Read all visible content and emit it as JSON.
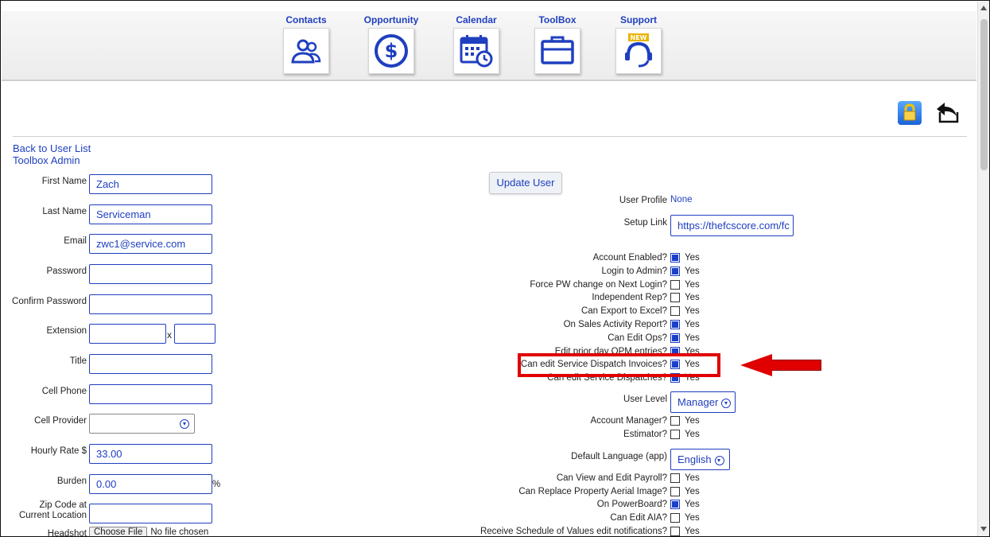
{
  "nav": [
    {
      "label": "Contacts",
      "icon": "contacts-icon"
    },
    {
      "label": "Opportunity",
      "icon": "dollar-icon"
    },
    {
      "label": "Calendar",
      "icon": "calendar-icon"
    },
    {
      "label": "ToolBox",
      "icon": "toolbox-icon"
    },
    {
      "label": "Support",
      "icon": "support-headset-icon",
      "badge": "NEW"
    }
  ],
  "links": {
    "back": "Back to User List",
    "admin": "Toolbox Admin"
  },
  "form": {
    "first_name": {
      "label": "First Name",
      "value": "Zach"
    },
    "last_name": {
      "label": "Last Name",
      "value": "Serviceman"
    },
    "email": {
      "label": "Email",
      "value": "zwc1@service.com"
    },
    "password": {
      "label": "Password",
      "value": ""
    },
    "confirm_password": {
      "label": "Confirm Password",
      "value": ""
    },
    "extension": {
      "label": "Extension",
      "value": "",
      "sep": "x",
      "value2": ""
    },
    "title": {
      "label": "Title",
      "value": ""
    },
    "cell_phone": {
      "label": "Cell Phone",
      "value": ""
    },
    "cell_provider": {
      "label": "Cell Provider",
      "value": ""
    },
    "hourly_rate": {
      "label": "Hourly Rate $",
      "value": "33.00"
    },
    "burden": {
      "label": "Burden",
      "value": "0.00",
      "suffix": "%"
    },
    "zip_code": {
      "label_line1": "Zip Code at",
      "label_line2": "Current Location",
      "value": ""
    },
    "headshot": {
      "label": "Headshot",
      "button": "Choose File",
      "status": "No file chosen"
    }
  },
  "update_button": "Update User",
  "right": {
    "user_profile": {
      "label": "User Profile",
      "value": "None"
    },
    "setup_link": {
      "label": "Setup Link",
      "value": "https://thefcscore.com/fc"
    },
    "checks": [
      {
        "label": "Account Enabled?",
        "checked": true,
        "text": "Yes"
      },
      {
        "label": "Login to Admin?",
        "checked": true,
        "text": "Yes"
      },
      {
        "label": "Force PW change on Next Login?",
        "checked": false,
        "text": "Yes"
      },
      {
        "label": "Independent Rep?",
        "checked": false,
        "text": "Yes"
      },
      {
        "label": "Can Export to Excel?",
        "checked": false,
        "text": "Yes"
      },
      {
        "label": "On Sales Activity Report?",
        "checked": true,
        "text": "Yes"
      },
      {
        "label": "Can Edit Ops?",
        "checked": true,
        "text": "Yes"
      },
      {
        "label": "Edit prior day OPM entries?",
        "checked": true,
        "text": "Yes"
      },
      {
        "label": "Can edit Service Dispatch Invoices?",
        "checked": true,
        "text": "Yes"
      },
      {
        "label": "Can edit Service Dispatches?",
        "checked": true,
        "text": "Yes"
      }
    ],
    "user_level": {
      "label": "User Level",
      "value": "Manager"
    },
    "checks2": [
      {
        "label": "Account Manager?",
        "checked": false,
        "text": "Yes"
      },
      {
        "label": "Estimator?",
        "checked": false,
        "text": "Yes"
      }
    ],
    "language": {
      "label": "Default Language (app)",
      "value": "English"
    },
    "checks3": [
      {
        "label": "Can View and Edit Payroll?",
        "checked": false,
        "text": "Yes"
      },
      {
        "label": "Can Replace Property Aerial Image?",
        "checked": false,
        "text": "Yes"
      },
      {
        "label": "On PowerBoard?",
        "checked": true,
        "text": "Yes"
      },
      {
        "label": "Can Edit AIA?",
        "checked": false,
        "text": "Yes"
      },
      {
        "label": "Receive Schedule of Values edit notifications?",
        "checked": false,
        "text": "Yes"
      }
    ]
  },
  "colors": {
    "accent": "#1f3fbf",
    "checked": "#1b3fc9",
    "highlight": "#e00000"
  }
}
